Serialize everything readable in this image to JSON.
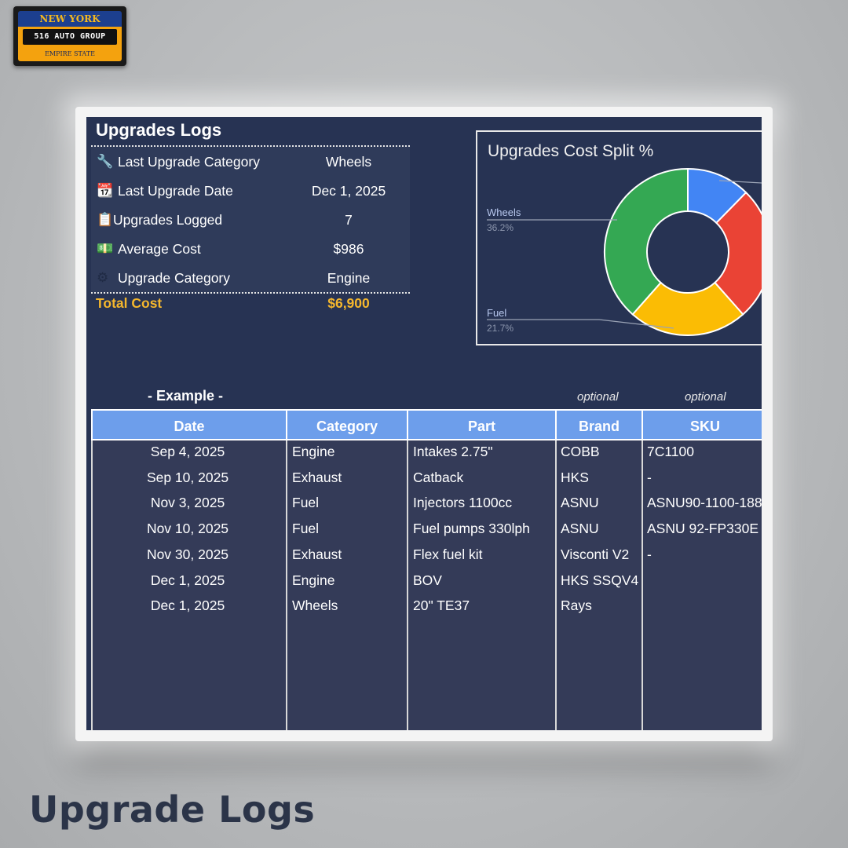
{
  "logo": {
    "top": "NEW YORK",
    "middle": "516 AUTO GROUP",
    "bottom": "EMPIRE STATE"
  },
  "summary": {
    "title": "Upgrades Logs",
    "rows": [
      {
        "icon": "🔧",
        "icon_name": "wrench-icon",
        "label": "Last Upgrade Category",
        "value": "Wheels"
      },
      {
        "icon": "📆",
        "icon_name": "calendar-icon",
        "label": "Last Upgrade Date",
        "value": "Dec 1, 2025"
      },
      {
        "icon": "📋",
        "icon_name": "clipboard-icon",
        "label": "Upgrades Logged",
        "value": "7"
      },
      {
        "icon": "💵",
        "icon_name": "money-icon",
        "label": "Average Cost",
        "value": "$986"
      },
      {
        "icon": "⚙",
        "icon_name": "gear-icon",
        "label": "Upgrade Category",
        "value": "Engine"
      }
    ],
    "total_label": "Total Cost",
    "total_value": "$6,900"
  },
  "chart_data": {
    "type": "pie",
    "title": "Upgrades Cost Split %",
    "style": "donut",
    "slices": [
      {
        "name": "",
        "value": 11.6,
        "color": "#4285f4"
      },
      {
        "name": "",
        "value": 24.6,
        "color": "#ea4335"
      },
      {
        "name": "Fuel",
        "value": 21.7,
        "color": "#fbbc04"
      },
      {
        "name": "Wheels",
        "value": 36.2,
        "color": "#34a853"
      }
    ],
    "labels": [
      {
        "name": "Wheels",
        "percent": "36.2%"
      },
      {
        "name": "Fuel",
        "percent": "21.7%"
      }
    ]
  },
  "table": {
    "example_label": "- Example -",
    "optional_label": "optional",
    "headers": [
      "Date",
      "Category",
      "Part",
      "Brand",
      "SKU"
    ],
    "rows": [
      [
        "Sep 4, 2025",
        "Engine",
        "Intakes 2.75\"",
        "COBB",
        "7C1100"
      ],
      [
        "Sep 10, 2025",
        "Exhaust",
        "Catback",
        "HKS",
        "-"
      ],
      [
        "Nov 3, 2025",
        "Fuel",
        "Injectors 1100cc",
        "ASNU",
        "ASNU90-1100-188"
      ],
      [
        "Nov 10, 2025",
        "Fuel",
        "Fuel pumps 330lph",
        "ASNU",
        "ASNU 92-FP330E"
      ],
      [
        "Nov 30, 2025",
        "Exhaust",
        "Flex fuel kit",
        "Visconti V2",
        "-"
      ],
      [
        "Dec 1, 2025",
        "Engine",
        "BOV",
        "HKS SSQV4",
        ""
      ],
      [
        "Dec 1, 2025",
        "Wheels",
        "20\" TE37",
        "Rays",
        ""
      ]
    ]
  },
  "caption": "Upgrade Logs",
  "colors": {
    "sheet_bg": "#273353",
    "header_blue": "#6d9eeb",
    "total_gold": "#f5b72d"
  }
}
